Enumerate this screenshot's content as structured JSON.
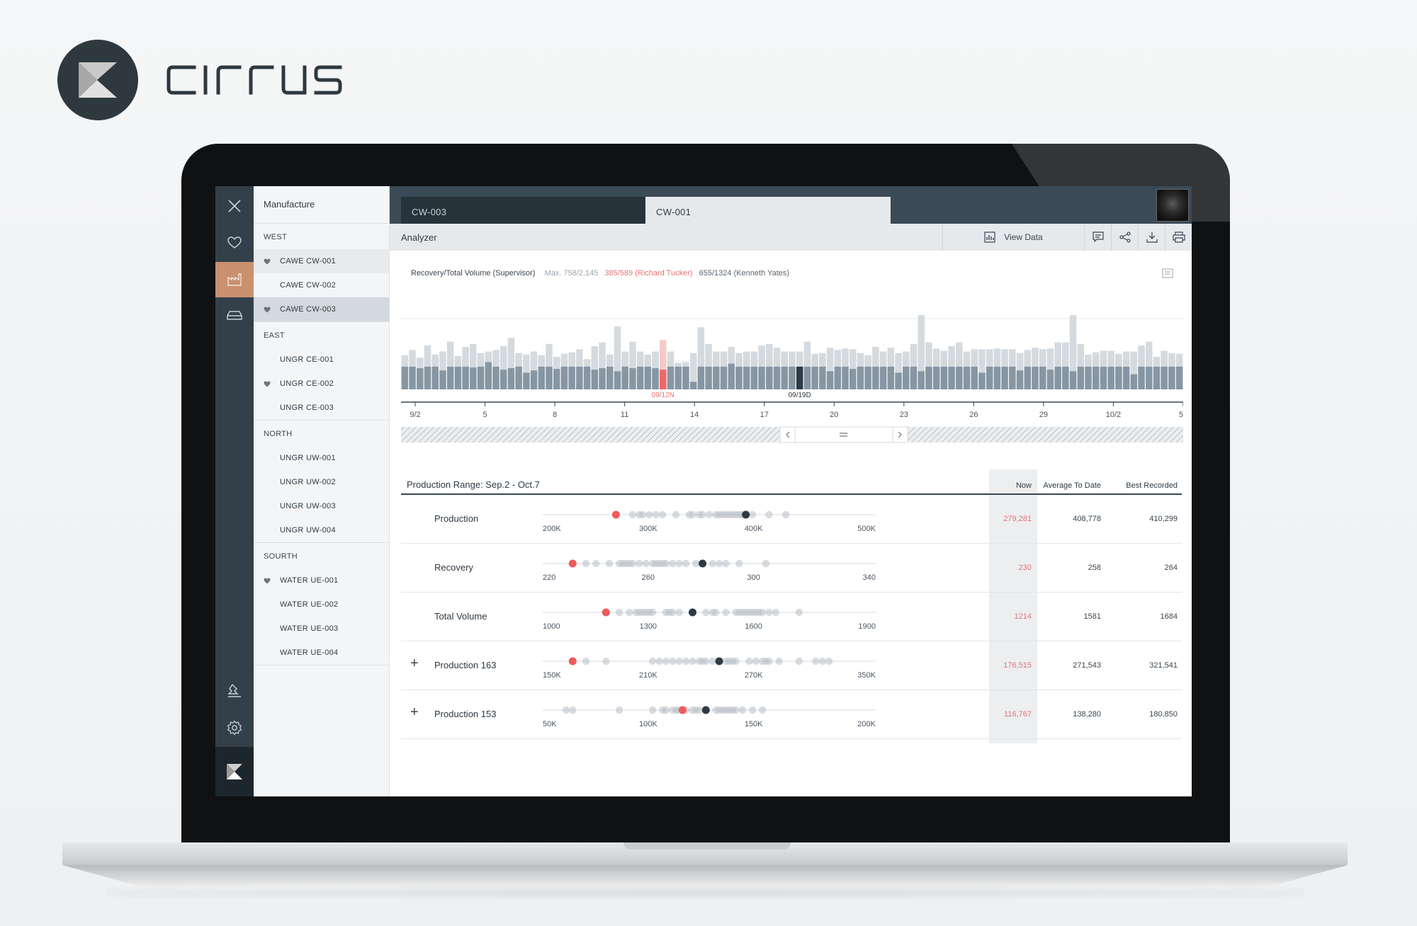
{
  "brand": {
    "name": "cirrus",
    "logo_icon": "cirrus-k-logo-icon"
  },
  "colors": {
    "accent": "#c9916e",
    "sidebar": "#33404a",
    "alert": "#e57373",
    "highlight": "#2e3a44"
  },
  "nav": {
    "title": "Manufacture",
    "groups": [
      {
        "label": "WEST",
        "items": [
          {
            "label": "CAWE CW-001",
            "favorite": true
          },
          {
            "label": "CAWE CW-002",
            "favorite": false
          },
          {
            "label": "CAWE CW-003",
            "favorite": true
          }
        ]
      },
      {
        "label": "EAST",
        "items": [
          {
            "label": "UNGR CE-001",
            "favorite": false
          },
          {
            "label": "UNGR CE-002",
            "favorite": true
          },
          {
            "label": "UNGR  CE-003",
            "favorite": false
          }
        ]
      },
      {
        "label": "NORTH",
        "items": [
          {
            "label": "UNGR  UW-001",
            "favorite": false
          },
          {
            "label": "UNGR UW-002",
            "favorite": false
          },
          {
            "label": "UNGR UW-003",
            "favorite": false
          },
          {
            "label": "UNGR UW-004",
            "favorite": false
          }
        ]
      },
      {
        "label": "SOURTH",
        "items": [
          {
            "label": "WATER UE-001",
            "favorite": true
          },
          {
            "label": "WATER UE-002",
            "favorite": false
          },
          {
            "label": "WATER UE-003",
            "favorite": false
          },
          {
            "label": "WATER UE-004",
            "favorite": false
          }
        ]
      }
    ]
  },
  "tabs": [
    {
      "label": "CW-003",
      "active": false
    },
    {
      "label": "CW-001",
      "active": true
    }
  ],
  "toolbar": {
    "title": "Analyzer",
    "view_data": "View Data",
    "icons": [
      "bar-chart-icon",
      "comment-icon",
      "share-icon",
      "download-icon",
      "print-icon"
    ]
  },
  "chart_header": {
    "title": "Recovery/Total Volume (Supervisor)",
    "max": "Max. 758/2,145",
    "red_note": "385/589 (Richard Tucker)",
    "dark_note": "655/1324 (Kenneth Yates)"
  },
  "chart_data": {
    "type": "bar",
    "x_ticks": [
      "9/2",
      "5",
      "8",
      "11",
      "14",
      "17",
      "20",
      "23",
      "26",
      "29",
      "10/2",
      "5"
    ],
    "back_values": [
      0.45,
      0.52,
      0.42,
      0.58,
      0.46,
      0.5,
      0.63,
      0.44,
      0.56,
      0.6,
      0.48,
      0.5,
      0.52,
      0.57,
      0.68,
      0.48,
      0.46,
      0.5,
      0.45,
      0.6,
      0.43,
      0.47,
      0.49,
      0.53,
      0.4,
      0.57,
      0.62,
      0.46,
      0.83,
      0.5,
      0.63,
      0.5,
      0.46,
      0.5,
      0.65,
      0.5,
      0.35,
      0.36,
      0.48,
      0.82,
      0.6,
      0.5,
      0.5,
      0.56,
      0.48,
      0.5,
      0.5,
      0.58,
      0.6,
      0.55,
      0.5,
      0.5,
      0.5,
      0.63,
      0.47,
      0.48,
      0.55,
      0.52,
      0.54,
      0.53,
      0.48,
      0.45,
      0.56,
      0.5,
      0.55,
      0.48,
      0.5,
      0.6,
      0.98,
      0.62,
      0.54,
      0.51,
      0.57,
      0.62,
      0.5,
      0.53,
      0.53,
      0.53,
      0.54,
      0.53,
      0.53,
      0.48,
      0.52,
      0.55,
      0.53,
      0.54,
      0.62,
      0.62,
      0.98,
      0.6,
      0.46,
      0.49,
      0.51,
      0.51,
      0.47,
      0.5,
      0.5,
      0.58,
      0.63,
      0.43,
      0.51,
      0.48,
      0.47
    ],
    "front_values": [
      0.3,
      0.3,
      0.28,
      0.3,
      0.3,
      0.25,
      0.3,
      0.3,
      0.3,
      0.29,
      0.3,
      0.36,
      0.3,
      0.26,
      0.28,
      0.3,
      0.22,
      0.25,
      0.3,
      0.3,
      0.27,
      0.3,
      0.3,
      0.3,
      0.3,
      0.26,
      0.28,
      0.3,
      0.24,
      0.3,
      0.28,
      0.3,
      0.3,
      0.28,
      0.26,
      0.3,
      0.3,
      0.3,
      0.1,
      0.3,
      0.3,
      0.3,
      0.3,
      0.34,
      0.3,
      0.3,
      0.3,
      0.3,
      0.3,
      0.3,
      0.3,
      0.3,
      0.3,
      0.3,
      0.3,
      0.3,
      0.24,
      0.3,
      0.3,
      0.27,
      0.3,
      0.3,
      0.3,
      0.3,
      0.3,
      0.22,
      0.3,
      0.3,
      0.24,
      0.3,
      0.3,
      0.3,
      0.3,
      0.3,
      0.3,
      0.3,
      0.22,
      0.3,
      0.3,
      0.3,
      0.3,
      0.25,
      0.3,
      0.3,
      0.3,
      0.26,
      0.3,
      0.3,
      0.24,
      0.3,
      0.3,
      0.3,
      0.3,
      0.3,
      0.3,
      0.3,
      0.2,
      0.3,
      0.3,
      0.3,
      0.3,
      0.3,
      0.3
    ],
    "red_bar_index": 34,
    "red_label": "09/12N",
    "dark_bar_index": 52,
    "dark_label": "09/19D"
  },
  "range": {
    "title": "Production Range: Sep.2 - Oct.7",
    "columns": [
      "Now",
      "Average To Date",
      "Best Recorded"
    ],
    "rows": [
      {
        "label": "Production",
        "expandable": false,
        "ticks": [
          "200K",
          "300K",
          "400K",
          "500K"
        ],
        "now": "279,281",
        "avg": "408,778",
        "best": "410,299",
        "red": 0.22,
        "dark": 0.61,
        "dots": [
          0.27,
          0.29,
          0.3,
          0.32,
          0.34,
          0.36,
          0.4,
          0.44,
          0.45,
          0.47,
          0.48,
          0.5,
          0.52,
          0.53,
          0.54,
          0.55,
          0.56,
          0.57,
          0.58,
          0.59,
          0.6,
          0.63,
          0.68,
          0.73
        ]
      },
      {
        "label": "Recovery",
        "expandable": false,
        "ticks": [
          "220",
          "260",
          "300",
          "340"
        ],
        "now": "230",
        "avg": "258",
        "best": "264",
        "red": 0.09,
        "dark": 0.48,
        "dots": [
          0.13,
          0.16,
          0.2,
          0.23,
          0.24,
          0.25,
          0.26,
          0.27,
          0.29,
          0.31,
          0.33,
          0.34,
          0.35,
          0.36,
          0.37,
          0.39,
          0.41,
          0.43,
          0.46,
          0.51,
          0.53,
          0.55,
          0.59,
          0.67
        ]
      },
      {
        "label": "Total Volume",
        "expandable": false,
        "ticks": [
          "1000",
          "1300",
          "1600",
          "1900"
        ],
        "now": "1214",
        "avg": "1581",
        "best": "1684",
        "red": 0.19,
        "dark": 0.45,
        "dots": [
          0.23,
          0.26,
          0.28,
          0.29,
          0.3,
          0.31,
          0.32,
          0.33,
          0.37,
          0.38,
          0.39,
          0.41,
          0.49,
          0.51,
          0.52,
          0.55,
          0.58,
          0.59,
          0.6,
          0.61,
          0.62,
          0.63,
          0.64,
          0.65,
          0.66,
          0.68,
          0.7,
          0.77
        ]
      },
      {
        "label": "Production 163",
        "expandable": true,
        "ticks": [
          "150K",
          "210K",
          "270K",
          "350K"
        ],
        "now": "176,515",
        "avg": "271,543",
        "best": "321,541",
        "red": 0.09,
        "dark": 0.53,
        "dots": [
          0.13,
          0.19,
          0.33,
          0.35,
          0.37,
          0.39,
          0.41,
          0.43,
          0.45,
          0.47,
          0.48,
          0.49,
          0.51,
          0.55,
          0.56,
          0.57,
          0.58,
          0.62,
          0.64,
          0.66,
          0.67,
          0.68,
          0.71,
          0.77,
          0.82,
          0.84,
          0.86
        ]
      },
      {
        "label": "Production 153",
        "expandable": true,
        "ticks": [
          "50K",
          "100K",
          "150K",
          "200K"
        ],
        "now": "116,767",
        "avg": "138,280",
        "best": "180,850",
        "red": 0.42,
        "dark": 0.49,
        "dots": [
          0.07,
          0.09,
          0.23,
          0.33,
          0.36,
          0.37,
          0.39,
          0.4,
          0.41,
          0.43,
          0.45,
          0.46,
          0.47,
          0.52,
          0.53,
          0.54,
          0.55,
          0.56,
          0.57,
          0.58,
          0.6,
          0.63,
          0.66
        ]
      }
    ]
  }
}
